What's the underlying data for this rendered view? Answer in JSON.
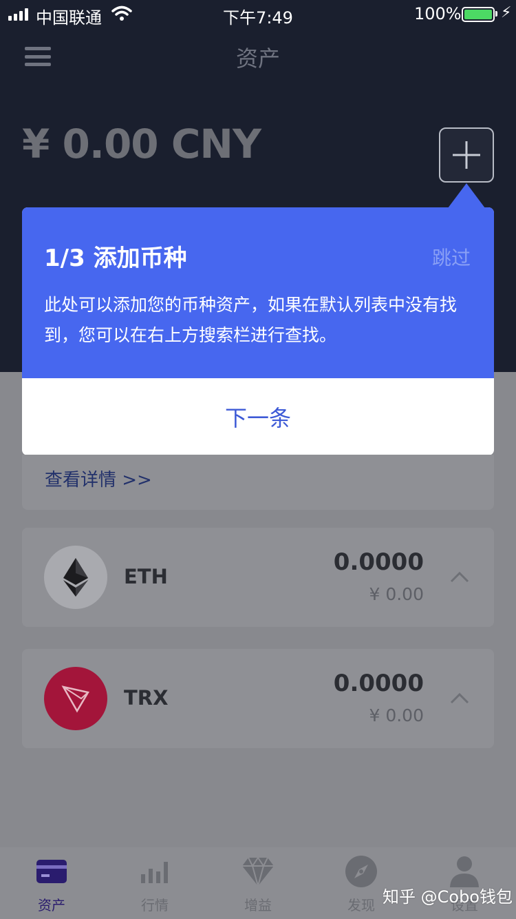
{
  "status_bar": {
    "carrier": "中国联通",
    "time": "下午7:49",
    "battery": "100%"
  },
  "header": {
    "title": "资产",
    "balance": "¥ 0.00 CNY"
  },
  "tooltip": {
    "title": "1/3 添加币种",
    "skip_label": "跳过",
    "body": "此处可以添加您的币种资产，如果在默认列表中没有找到，您可以在右上方搜索栏进行查找。",
    "next_label": "下一条"
  },
  "details_link": "查看详情 >>",
  "coins": [
    {
      "symbol": "ETH",
      "amount": "0.0000",
      "fiat": "¥ 0.00",
      "icon": "ethereum-icon"
    },
    {
      "symbol": "TRX",
      "amount": "0.0000",
      "fiat": "¥ 0.00",
      "icon": "tron-icon"
    }
  ],
  "tabs": [
    {
      "label": "资产",
      "icon": "wallet-card-icon",
      "active": true
    },
    {
      "label": "行情",
      "icon": "bar-chart-icon",
      "active": false
    },
    {
      "label": "增益",
      "icon": "diamond-icon",
      "active": false
    },
    {
      "label": "发现",
      "icon": "compass-icon",
      "active": false
    },
    {
      "label": "设置",
      "icon": "user-icon",
      "active": false
    }
  ],
  "watermark": "知乎 @Cobo钱包",
  "colors": {
    "accent_blue": "#4767ef",
    "header_dark": "#1a1f2e",
    "tron_red": "#a3153a",
    "active_tab": "#2a1c6e"
  }
}
